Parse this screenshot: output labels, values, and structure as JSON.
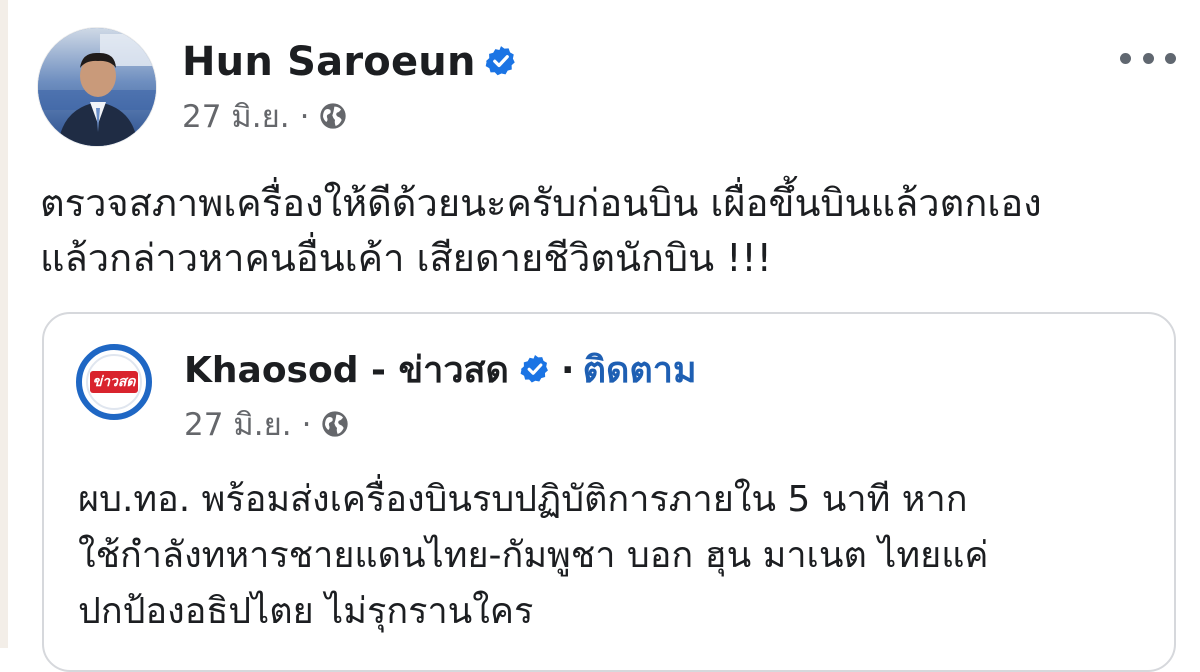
{
  "post": {
    "author_name": "Hun Saroeun",
    "date": "27 มิ.ย.",
    "separator": "·",
    "audience_icon": "globe-icon",
    "more_icon": "more-options-icon",
    "verified_icon": "verified-badge-icon",
    "text_lines": [
      "ตรวจสภาพเครื่องให้ดีด้วยนะครับก่อนบิน เผื่อขึ้นบินแล้วตกเอง",
      "แล้วกล่าวหาคนอื่นเค้า เสียดายชีวิตนักบิน !!!"
    ]
  },
  "shared": {
    "page_name": "Khaosod - ข่าวสด",
    "separator": "·",
    "follow_label": "ติดตาม",
    "logo_text": "ข่าวสด",
    "date": "27 มิ.ย.",
    "audience_icon": "globe-icon",
    "text_lines": [
      "ผบ.ทอ. พร้อมส่งเครื่องบินรบปฏิบัติการภายใน 5 นาที หาก",
      "ใช้กำลังทหารชายแดนไทย-กัมพูชา บอก ฮุน มาเนต ไทยแค่",
      "ปกป้องอธิปไตย ไม่รุกรานใคร"
    ]
  },
  "colors": {
    "verified_blue": "#1b74e4",
    "follow_blue": "#1e5fb3",
    "meta_gray": "#65676b",
    "card_border": "#d6d8dc",
    "logo_red": "#d9232d"
  }
}
